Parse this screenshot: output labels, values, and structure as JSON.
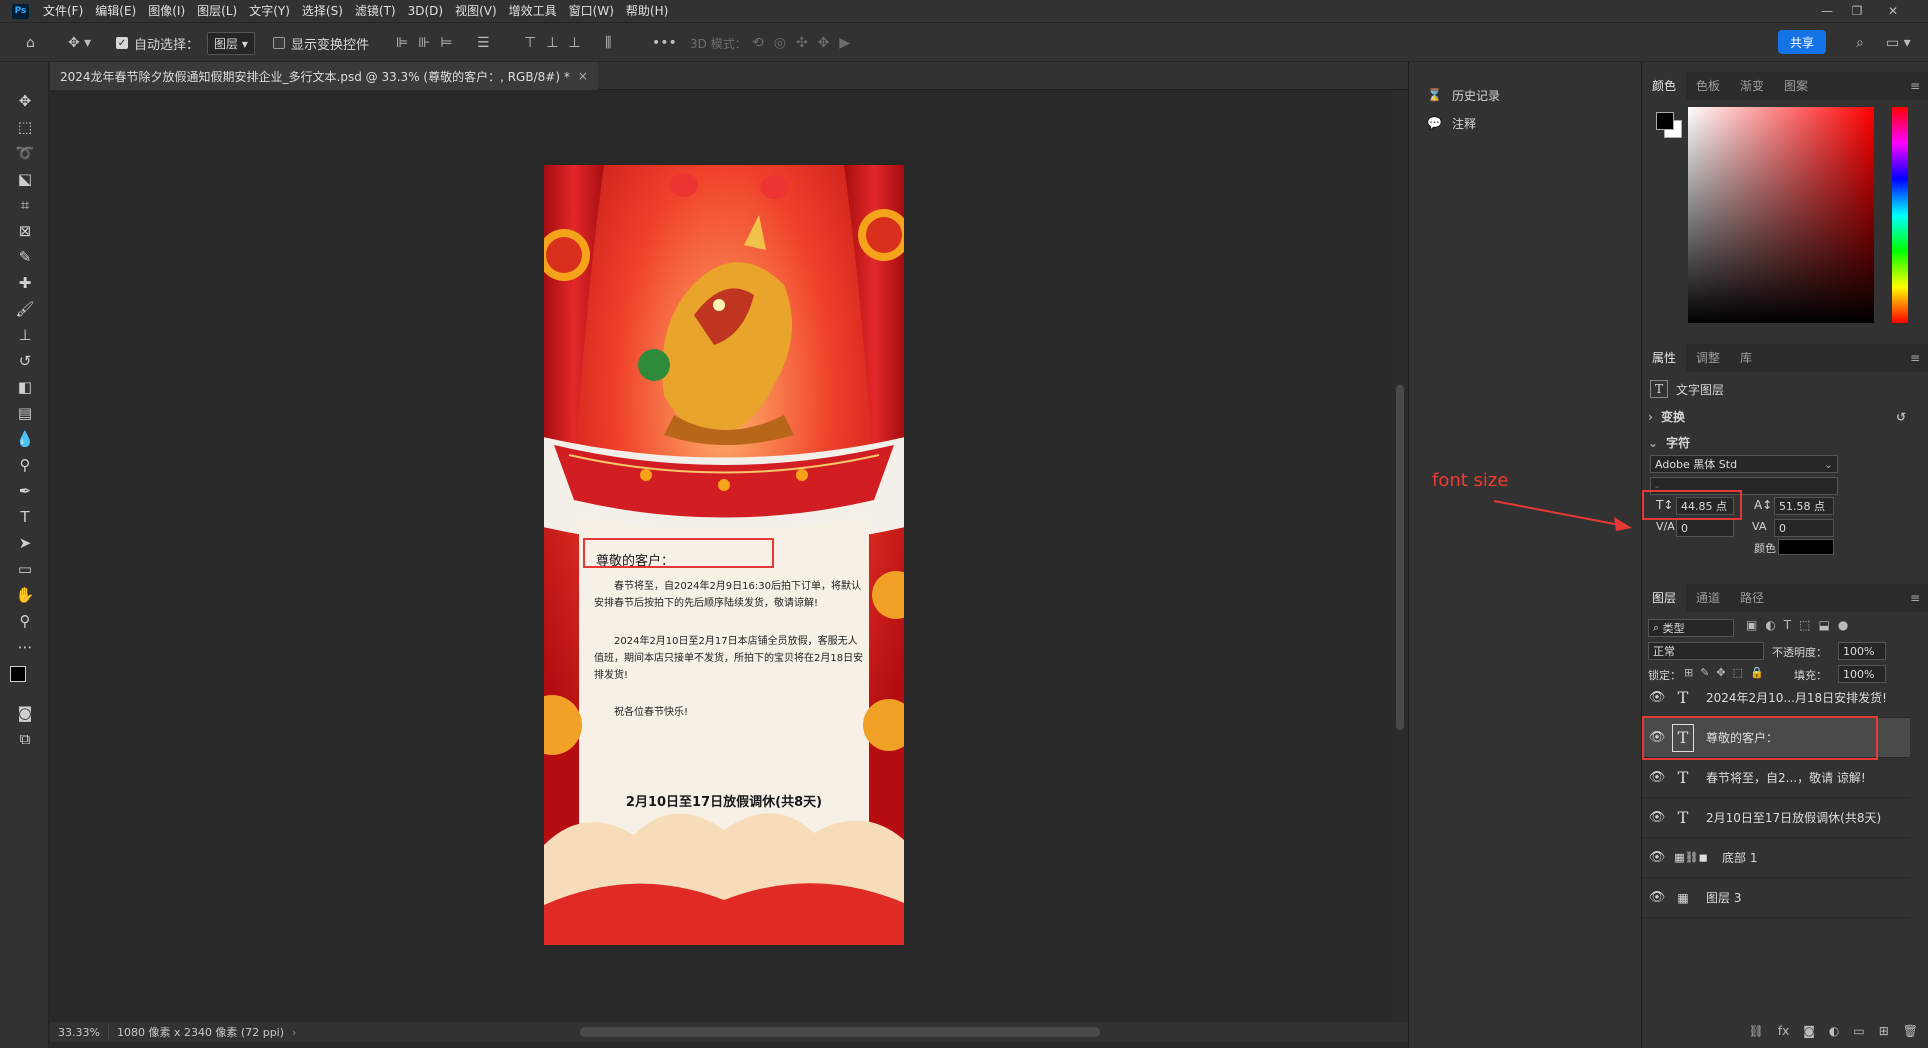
{
  "menubar": {
    "logo": "Ps",
    "items": [
      "文件(F)",
      "编辑(E)",
      "图像(I)",
      "图层(L)",
      "文字(Y)",
      "选择(S)",
      "滤镜(T)",
      "3D(D)",
      "视图(V)",
      "增效工具",
      "窗口(W)",
      "帮助(H)"
    ]
  },
  "options": {
    "auto_select_label": "自动选择：",
    "layer_select": "图层",
    "show_transform_label": "显示变换控件",
    "three_d_label": "3D 模式：",
    "share_label": "共享"
  },
  "document": {
    "tab_title": "2024龙年春节除夕放假通知假期安排企业_多行文本.psd @ 33.3% (尊敬的客户：, RGB/8#) *",
    "close": "×"
  },
  "poster": {
    "greeting": "尊敬的客户：",
    "paragraph1": "春节将至，自2024年2月9日16:30后拍下订单，将默认安排春节后按拍下的先后顺序陆续发货，敬请谅解!",
    "paragraph2": "2024年2月10日至2月17日本店铺全员放假，客服无人值班，期间本店只接单不发货，所拍下的宝贝将在2月18日安排发货!",
    "wish": "祝各位春节快乐!",
    "footer": "2月10日至17日放假调休(共8天)"
  },
  "statusbar": {
    "zoom": "33.33%",
    "dims": "1080 像素 x 2340 像素 (72 ppi)"
  },
  "mid_panel": {
    "items": [
      {
        "icon": "history-icon",
        "label": "历史记录"
      },
      {
        "icon": "comment-icon",
        "label": "注释"
      }
    ]
  },
  "color_panel": {
    "tabs": [
      "颜色",
      "色板",
      "渐变",
      "图案"
    ],
    "fg": "#000000",
    "bg": "#ffffff"
  },
  "properties": {
    "tabs": [
      "属性",
      "调整",
      "库"
    ],
    "layer_type": "文字图层",
    "transform_label": "变换",
    "character_label": "字符",
    "font_family": "Adobe 黑体 Std",
    "font_style": "-",
    "font_size": "44.85 点",
    "leading": "51.58 点",
    "kerning": "0",
    "tracking": "0",
    "color_label": "颜色",
    "color": "#000000"
  },
  "annotation": {
    "text": "font size"
  },
  "layers_panel": {
    "tabs": [
      "图层",
      "通道",
      "路径"
    ],
    "filter": "类型",
    "blend": "正常",
    "opacity_label": "不透明度：",
    "opacity": "100%",
    "lock_label": "锁定：",
    "fill_label": "填充：",
    "fill": "100%",
    "layers": [
      {
        "name": "2024年2月10...月18日安排发货!",
        "kind": "text"
      },
      {
        "name": "尊敬的客户：",
        "kind": "text",
        "selected": true
      },
      {
        "name": "春节将至，自2...，敬请 谅解!",
        "kind": "text"
      },
      {
        "name": "2月10日至17日放假调休(共8天)",
        "kind": "text"
      },
      {
        "name": "底部 1",
        "kind": "mask"
      },
      {
        "name": "图层 3",
        "kind": "pixel"
      }
    ]
  }
}
